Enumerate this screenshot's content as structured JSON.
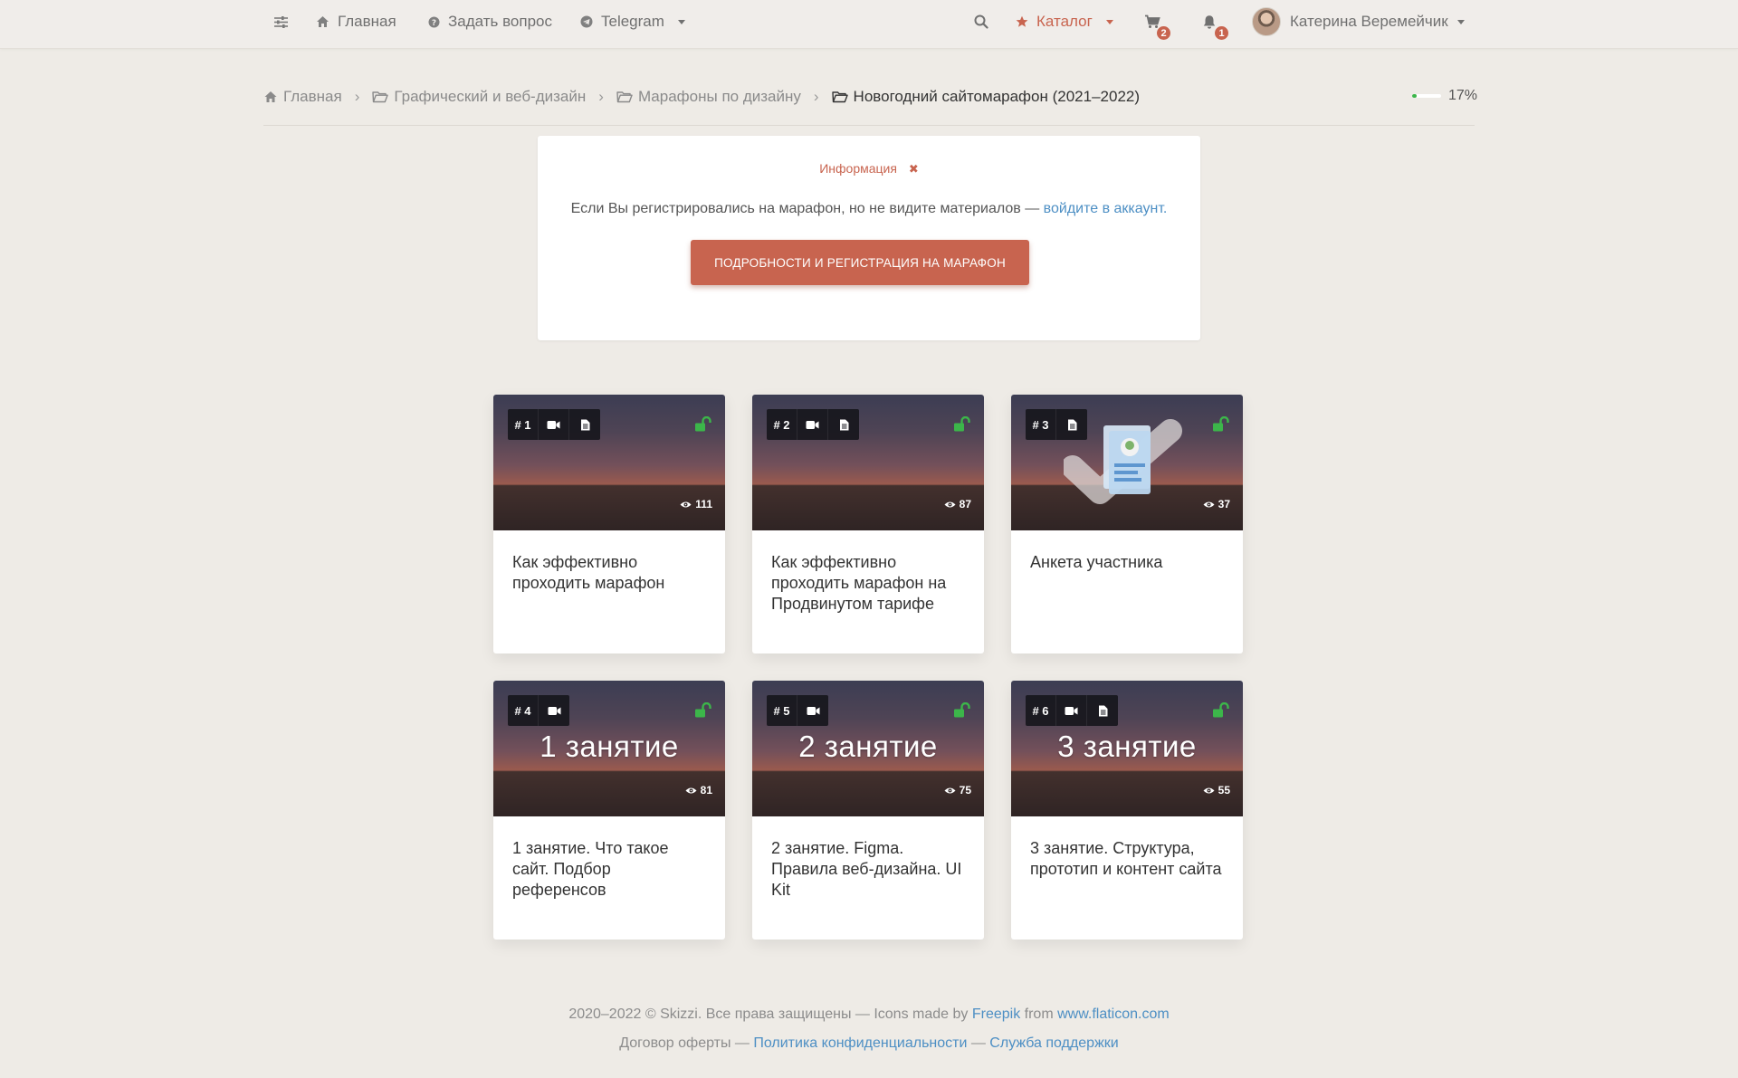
{
  "nav": {
    "home_label": "Главная",
    "ask_label": "Задать вопрос",
    "telegram_label": "Telegram",
    "catalog_label": "Каталог",
    "cart_count": "2",
    "notifications_count": "1",
    "user_name": "Катерина Веремейчик"
  },
  "breadcrumb": {
    "home": "Главная",
    "category": "Графический и веб-дизайн",
    "subcategory": "Марафоны по дизайну",
    "current": "Новогодний сайтомарафон (2021–2022)"
  },
  "progress": {
    "value": 17,
    "text": "17%"
  },
  "info": {
    "title": "Информация",
    "close_glyph": "✖",
    "text": "Если Вы регистрировались на марафон, но не видите материалов — ",
    "link": "войдите в аккаунт.",
    "button": "ПОДРОБНОСТИ И РЕГИСТРАЦИЯ НА МАРАФОН"
  },
  "lessons": [
    {
      "number": "# 1",
      "has_video": true,
      "has_doc": true,
      "views": "111",
      "big_text": "",
      "title": "Как эффективно проходить марафон"
    },
    {
      "number": "# 2",
      "has_video": true,
      "has_doc": true,
      "views": "87",
      "big_text": "",
      "title": "Как эффективно проходить марафон на Продвинутом тарифе"
    },
    {
      "number": "# 3",
      "has_video": false,
      "has_doc": true,
      "views": "37",
      "big_text": "",
      "title": "Анкета участника"
    },
    {
      "number": "# 4",
      "has_video": true,
      "has_doc": false,
      "views": "81",
      "big_text": "1 занятие",
      "title": "1 занятие. Что такое сайт. Подбор референсов"
    },
    {
      "number": "# 5",
      "has_video": true,
      "has_doc": false,
      "views": "75",
      "big_text": "2 занятие",
      "title": "2 занятие. Figma. Правила веб-дизайна. UI Kit"
    },
    {
      "number": "# 6",
      "has_video": true,
      "has_doc": true,
      "views": "55",
      "big_text": "3 занятие",
      "title": "3 занятие. Структура, прототип и контент сайта"
    }
  ],
  "footer": {
    "copyright": "2020–2022 © Skizzi. Все права защищены — Icons made by ",
    "freepik": "Freepik",
    "from": " from ",
    "flaticon": "www.flaticon.com",
    "offer": "Договор оферты — ",
    "privacy": "Политика конфиденциальности",
    "dash": " — ",
    "support": "Служба поддержки"
  },
  "colors": {
    "accent": "#c8644f",
    "link": "#4d8fc4",
    "lock_green": "#3cb64a",
    "background": "#eeebe6"
  },
  "icons": [
    "sliders-icon",
    "home-icon",
    "question-icon",
    "telegram-icon",
    "search-icon",
    "star-icon",
    "cart-icon",
    "bell-icon",
    "folder-icon",
    "video-icon",
    "document-icon",
    "unlock-icon",
    "eye-icon"
  ]
}
